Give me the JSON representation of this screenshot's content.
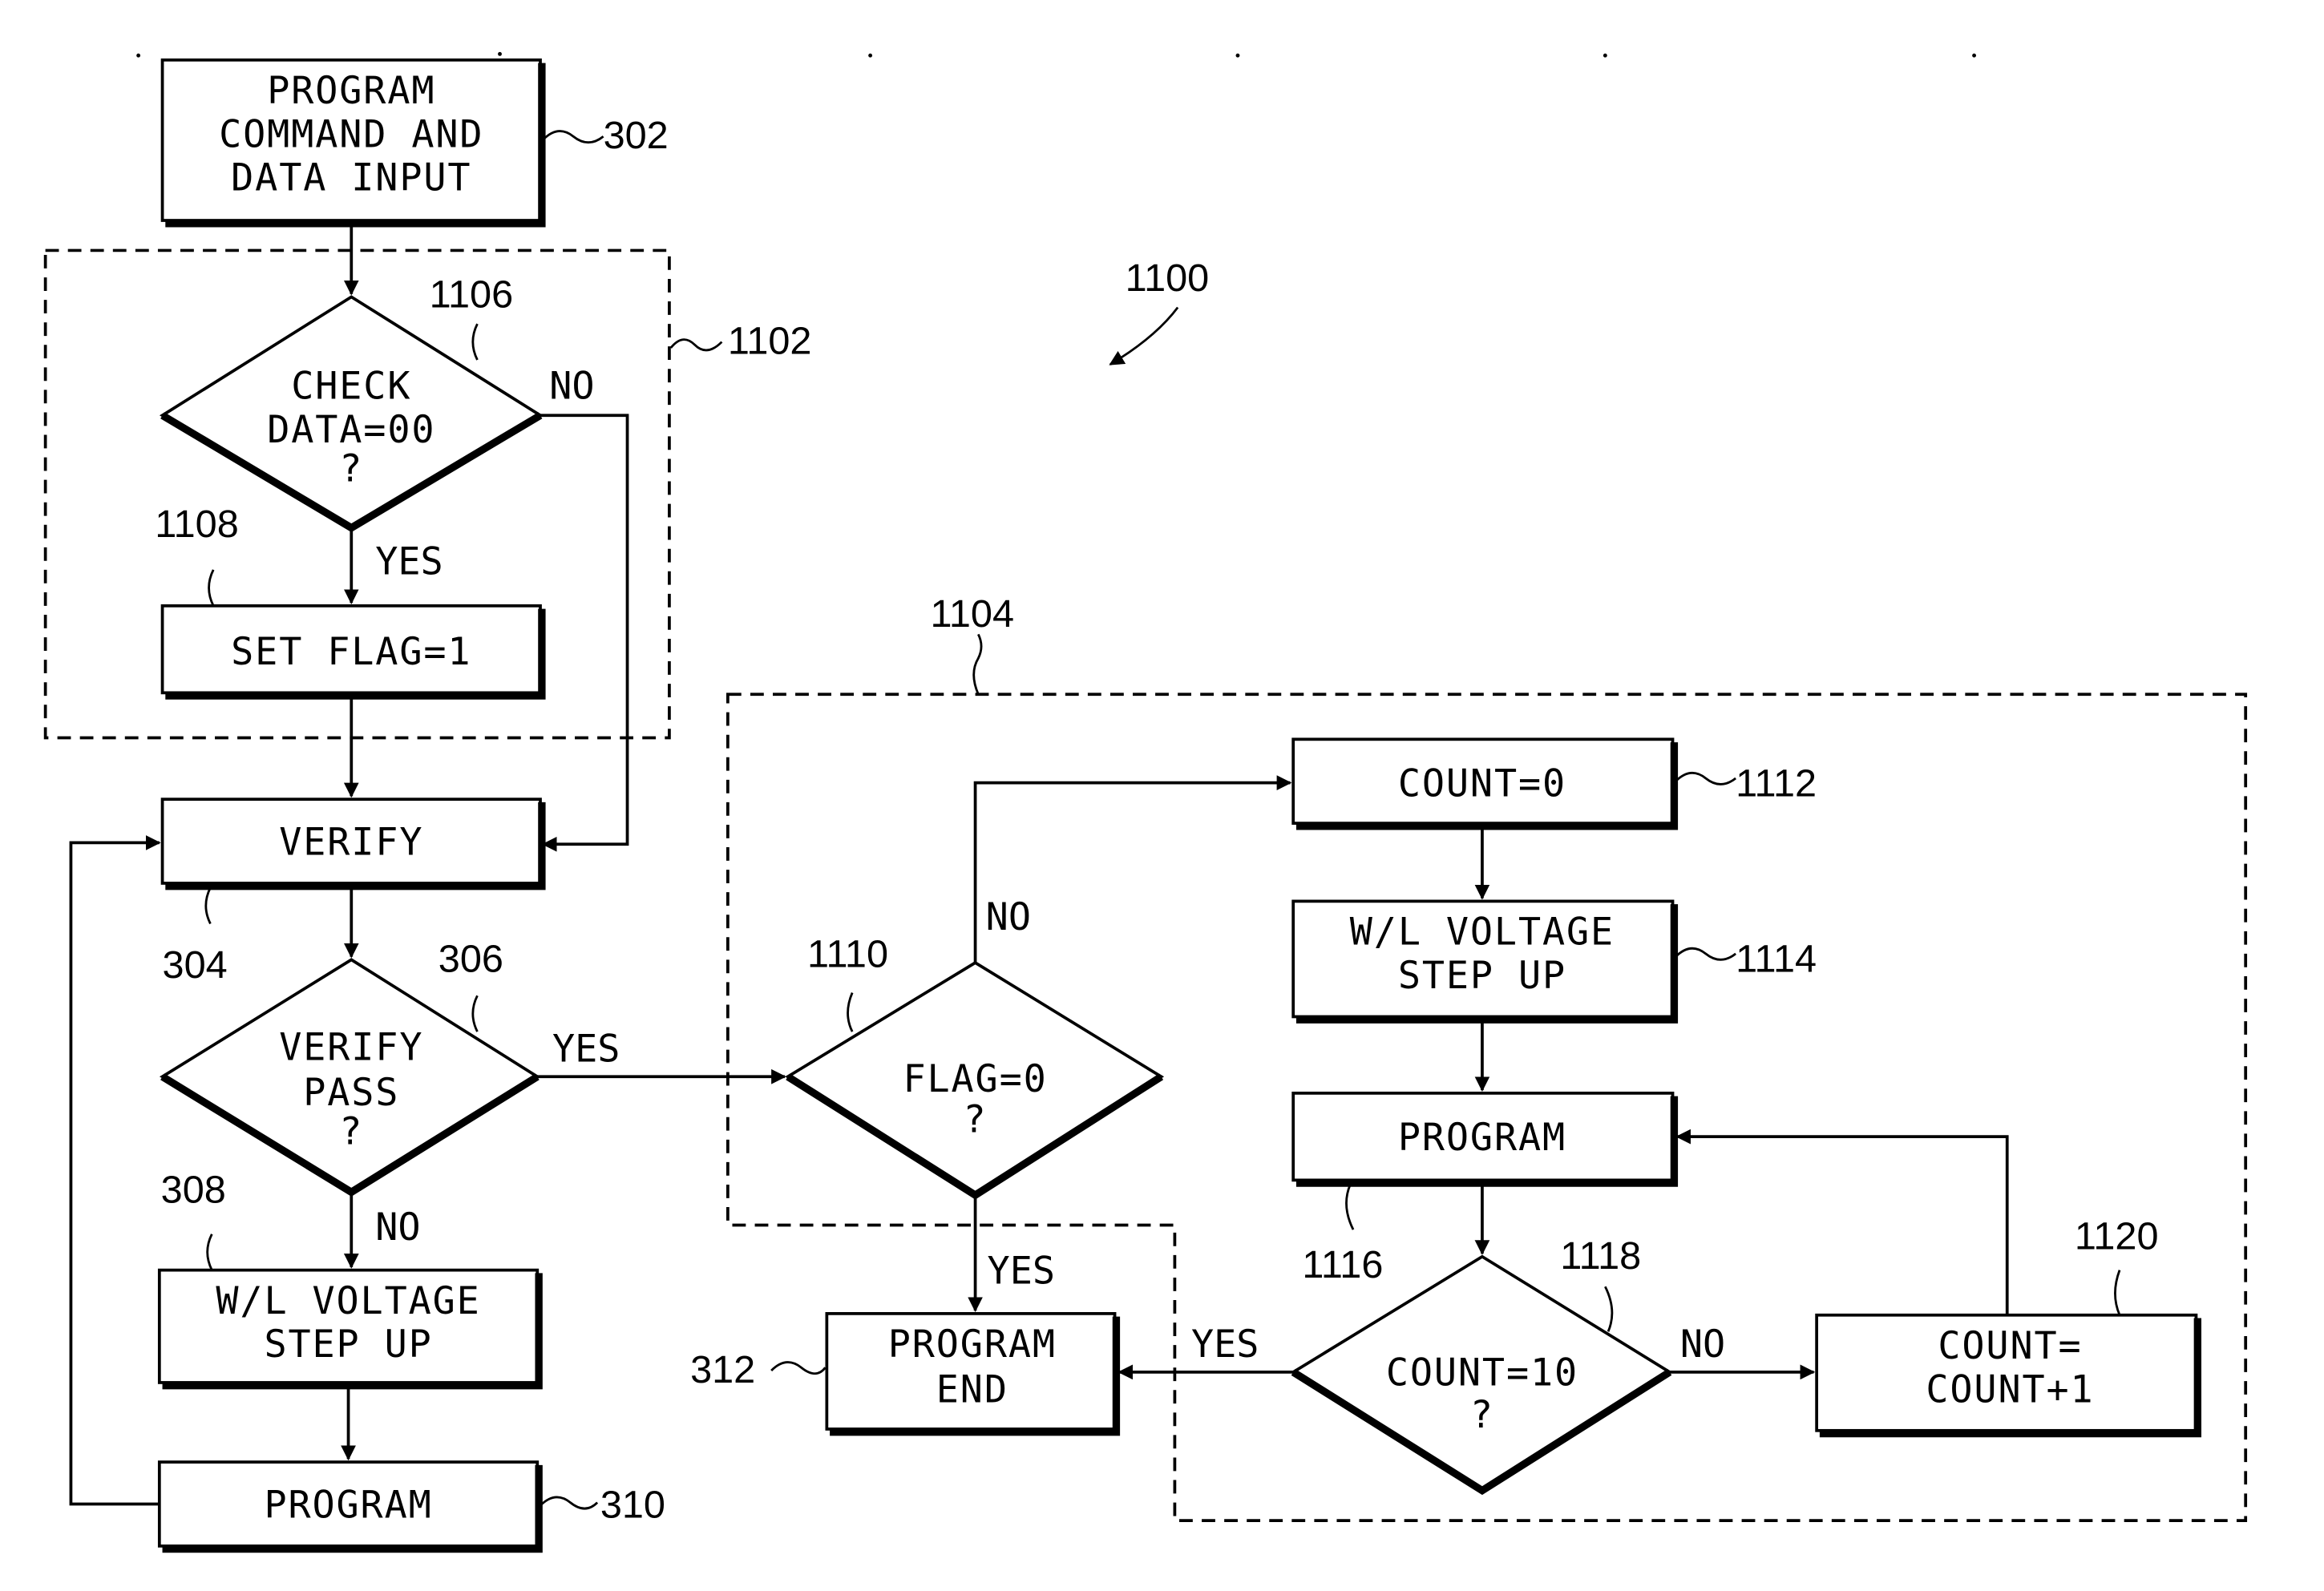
{
  "figure_ref": "1100",
  "groups": {
    "check_group_ref": "1102",
    "flag_group_ref": "1104"
  },
  "nodes": {
    "n302": {
      "ref": "302",
      "lines": [
        "PROGRAM",
        "COMMAND AND",
        "DATA INPUT"
      ]
    },
    "n1106": {
      "ref": "1106",
      "lines": [
        "CHECK",
        "DATA=00",
        "?"
      ]
    },
    "n1108": {
      "ref": "1108",
      "lines": [
        "SET FLAG=1"
      ]
    },
    "n304": {
      "ref": "304",
      "lines": [
        "VERIFY"
      ]
    },
    "n306": {
      "ref": "306",
      "lines": [
        "VERIFY",
        "PASS",
        "?"
      ]
    },
    "n308": {
      "ref": "308",
      "lines": [
        "W/L VOLTAGE",
        "STEP UP"
      ]
    },
    "n310": {
      "ref": "310",
      "lines": [
        "PROGRAM"
      ]
    },
    "n1110": {
      "ref": "1110",
      "lines": [
        "FLAG=0",
        "?"
      ]
    },
    "n312": {
      "ref": "312",
      "lines": [
        "PROGRAM",
        "END"
      ]
    },
    "n1112": {
      "ref": "1112",
      "lines": [
        "COUNT=0"
      ]
    },
    "n1114": {
      "ref": "1114",
      "lines": [
        "W/L VOLTAGE",
        "STEP UP"
      ]
    },
    "n1116": {
      "ref": "1116",
      "lines": [
        "PROGRAM"
      ]
    },
    "n1118": {
      "ref": "1118",
      "lines": [
        "COUNT=10",
        "?"
      ]
    },
    "n1120": {
      "ref": "1120",
      "lines": [
        "COUNT=",
        "COUNT+1"
      ]
    }
  },
  "edge_labels": {
    "yes": "YES",
    "no": "NO"
  }
}
